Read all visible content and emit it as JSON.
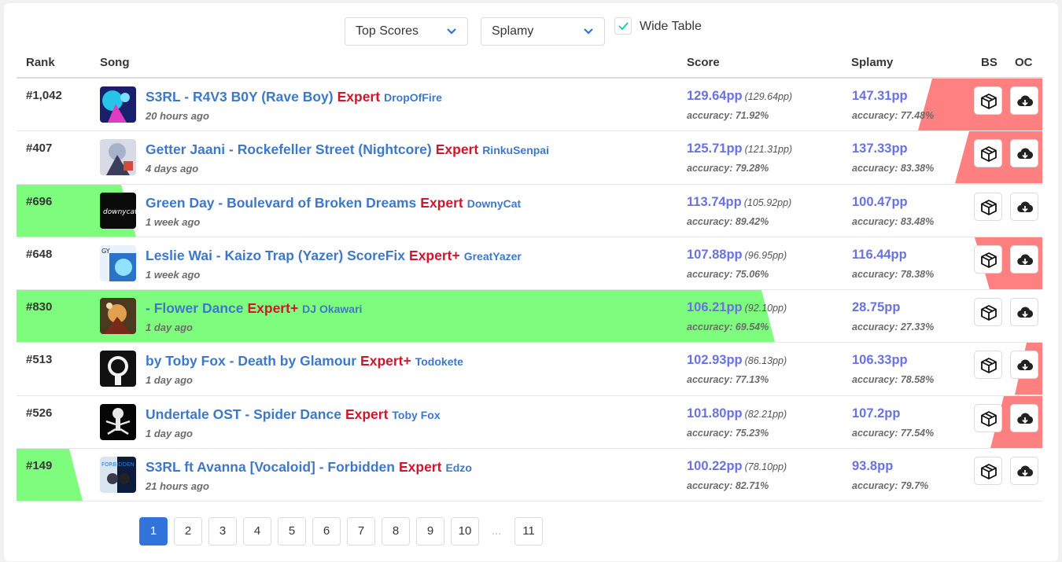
{
  "controls": {
    "score_type": "Top Scores",
    "ranking": "Splamy",
    "wide_table_label": "Wide Table",
    "wide_table_checked": true
  },
  "headers": {
    "rank": "Rank",
    "song": "Song",
    "score": "Score",
    "splamy": "Splamy",
    "bs": "BS",
    "oc": "OC"
  },
  "colors": {
    "link": "#3e78c9",
    "difficulty": "#d0162c",
    "pp": "#6a72e0",
    "better_green": "#7dfc7d",
    "worse_red": "#ff8080",
    "active_page": "#3273dc"
  },
  "rows": [
    {
      "rank": "#1,042",
      "song": "S3RL - R4V3 B0Y (Rave Boy)",
      "difficulty": "Expert",
      "mapper": "DropOfFire",
      "time": "20 hours ago",
      "score_pp": "129.64pp",
      "score_raw": "(129.64pp)",
      "score_acc": "accuracy: 71.92%",
      "splamy_pp": "147.31pp",
      "splamy_acc": "accuracy: 77.48%",
      "cover": "cover-rave-boy"
    },
    {
      "rank": "#407",
      "song": "Getter Jaani - Rockefeller Street (Nightcore)",
      "difficulty": "Expert",
      "mapper": "RinkuSenpai",
      "time": "4 days ago",
      "score_pp": "125.71pp",
      "score_raw": "(121.31pp)",
      "score_acc": "accuracy: 79.28%",
      "splamy_pp": "137.33pp",
      "splamy_acc": "accuracy: 83.38%",
      "cover": "cover-rockefeller"
    },
    {
      "rank": "#696",
      "song": "Green Day - Boulevard of Broken Dreams",
      "difficulty": "Expert",
      "mapper": "DownyCat",
      "time": "1 week ago",
      "score_pp": "113.74pp",
      "score_raw": "(105.92pp)",
      "score_acc": "accuracy: 89.42%",
      "splamy_pp": "100.47pp",
      "splamy_acc": "accuracy: 83.48%",
      "cover": "cover-downycat",
      "cover_text": "downycat"
    },
    {
      "rank": "#648",
      "song": "Leslie Wai - Kaizo Trap (Yazer) ScoreFix",
      "difficulty": "Expert+",
      "mapper": "GreatYazer",
      "time": "1 week ago",
      "score_pp": "107.88pp",
      "score_raw": "(96.95pp)",
      "score_acc": "accuracy: 75.06%",
      "splamy_pp": "116.44pp",
      "splamy_acc": "accuracy: 78.38%",
      "cover": "cover-kaizo-trap",
      "cover_text": "GY"
    },
    {
      "rank": "#830",
      "song": "- Flower Dance",
      "difficulty": "Expert+",
      "mapper": "DJ Okawari",
      "time": "1 day ago",
      "score_pp": "106.21pp",
      "score_raw": "(92.10pp)",
      "score_acc": "accuracy: 69.54%",
      "splamy_pp": "28.75pp",
      "splamy_acc": "accuracy: 27.33%",
      "cover": "cover-flower-dance"
    },
    {
      "rank": "#513",
      "song": "by Toby Fox - Death by Glamour",
      "difficulty": "Expert+",
      "mapper": "Todokete",
      "time": "1 day ago",
      "score_pp": "102.93pp",
      "score_raw": "(86.13pp)",
      "score_acc": "accuracy: 77.13%",
      "splamy_pp": "106.33pp",
      "splamy_acc": "accuracy: 78.58%",
      "cover": "cover-death-by-glamour"
    },
    {
      "rank": "#526",
      "song": "Undertale OST - Spider Dance",
      "difficulty": "Expert",
      "mapper": "Toby Fox",
      "time": "1 day ago",
      "score_pp": "101.80pp",
      "score_raw": "(82.21pp)",
      "score_acc": "accuracy: 75.23%",
      "splamy_pp": "107.2pp",
      "splamy_acc": "accuracy: 77.54%",
      "cover": "cover-spider-dance"
    },
    {
      "rank": "#149",
      "song": "S3RL ft Avanna [Vocaloid] - Forbidden",
      "difficulty": "Expert",
      "mapper": "Edzo",
      "time": "21 hours ago",
      "score_pp": "100.22pp",
      "score_raw": "(78.10pp)",
      "score_acc": "accuracy: 82.71%",
      "splamy_pp": "93.8pp",
      "splamy_acc": "accuracy: 79.7%",
      "cover": "cover-forbidden",
      "cover_text": "FORBIDDEN"
    }
  ],
  "icons": {
    "bs": "beat-saver-cube-icon",
    "oc": "cloud-download-icon",
    "chevron": "chevron-down-icon",
    "check": "check-icon"
  },
  "pagination": {
    "pages": [
      "1",
      "2",
      "3",
      "4",
      "5",
      "6",
      "7",
      "8",
      "9",
      "10"
    ],
    "ellipsis": "...",
    "last": "11",
    "current": "1"
  }
}
